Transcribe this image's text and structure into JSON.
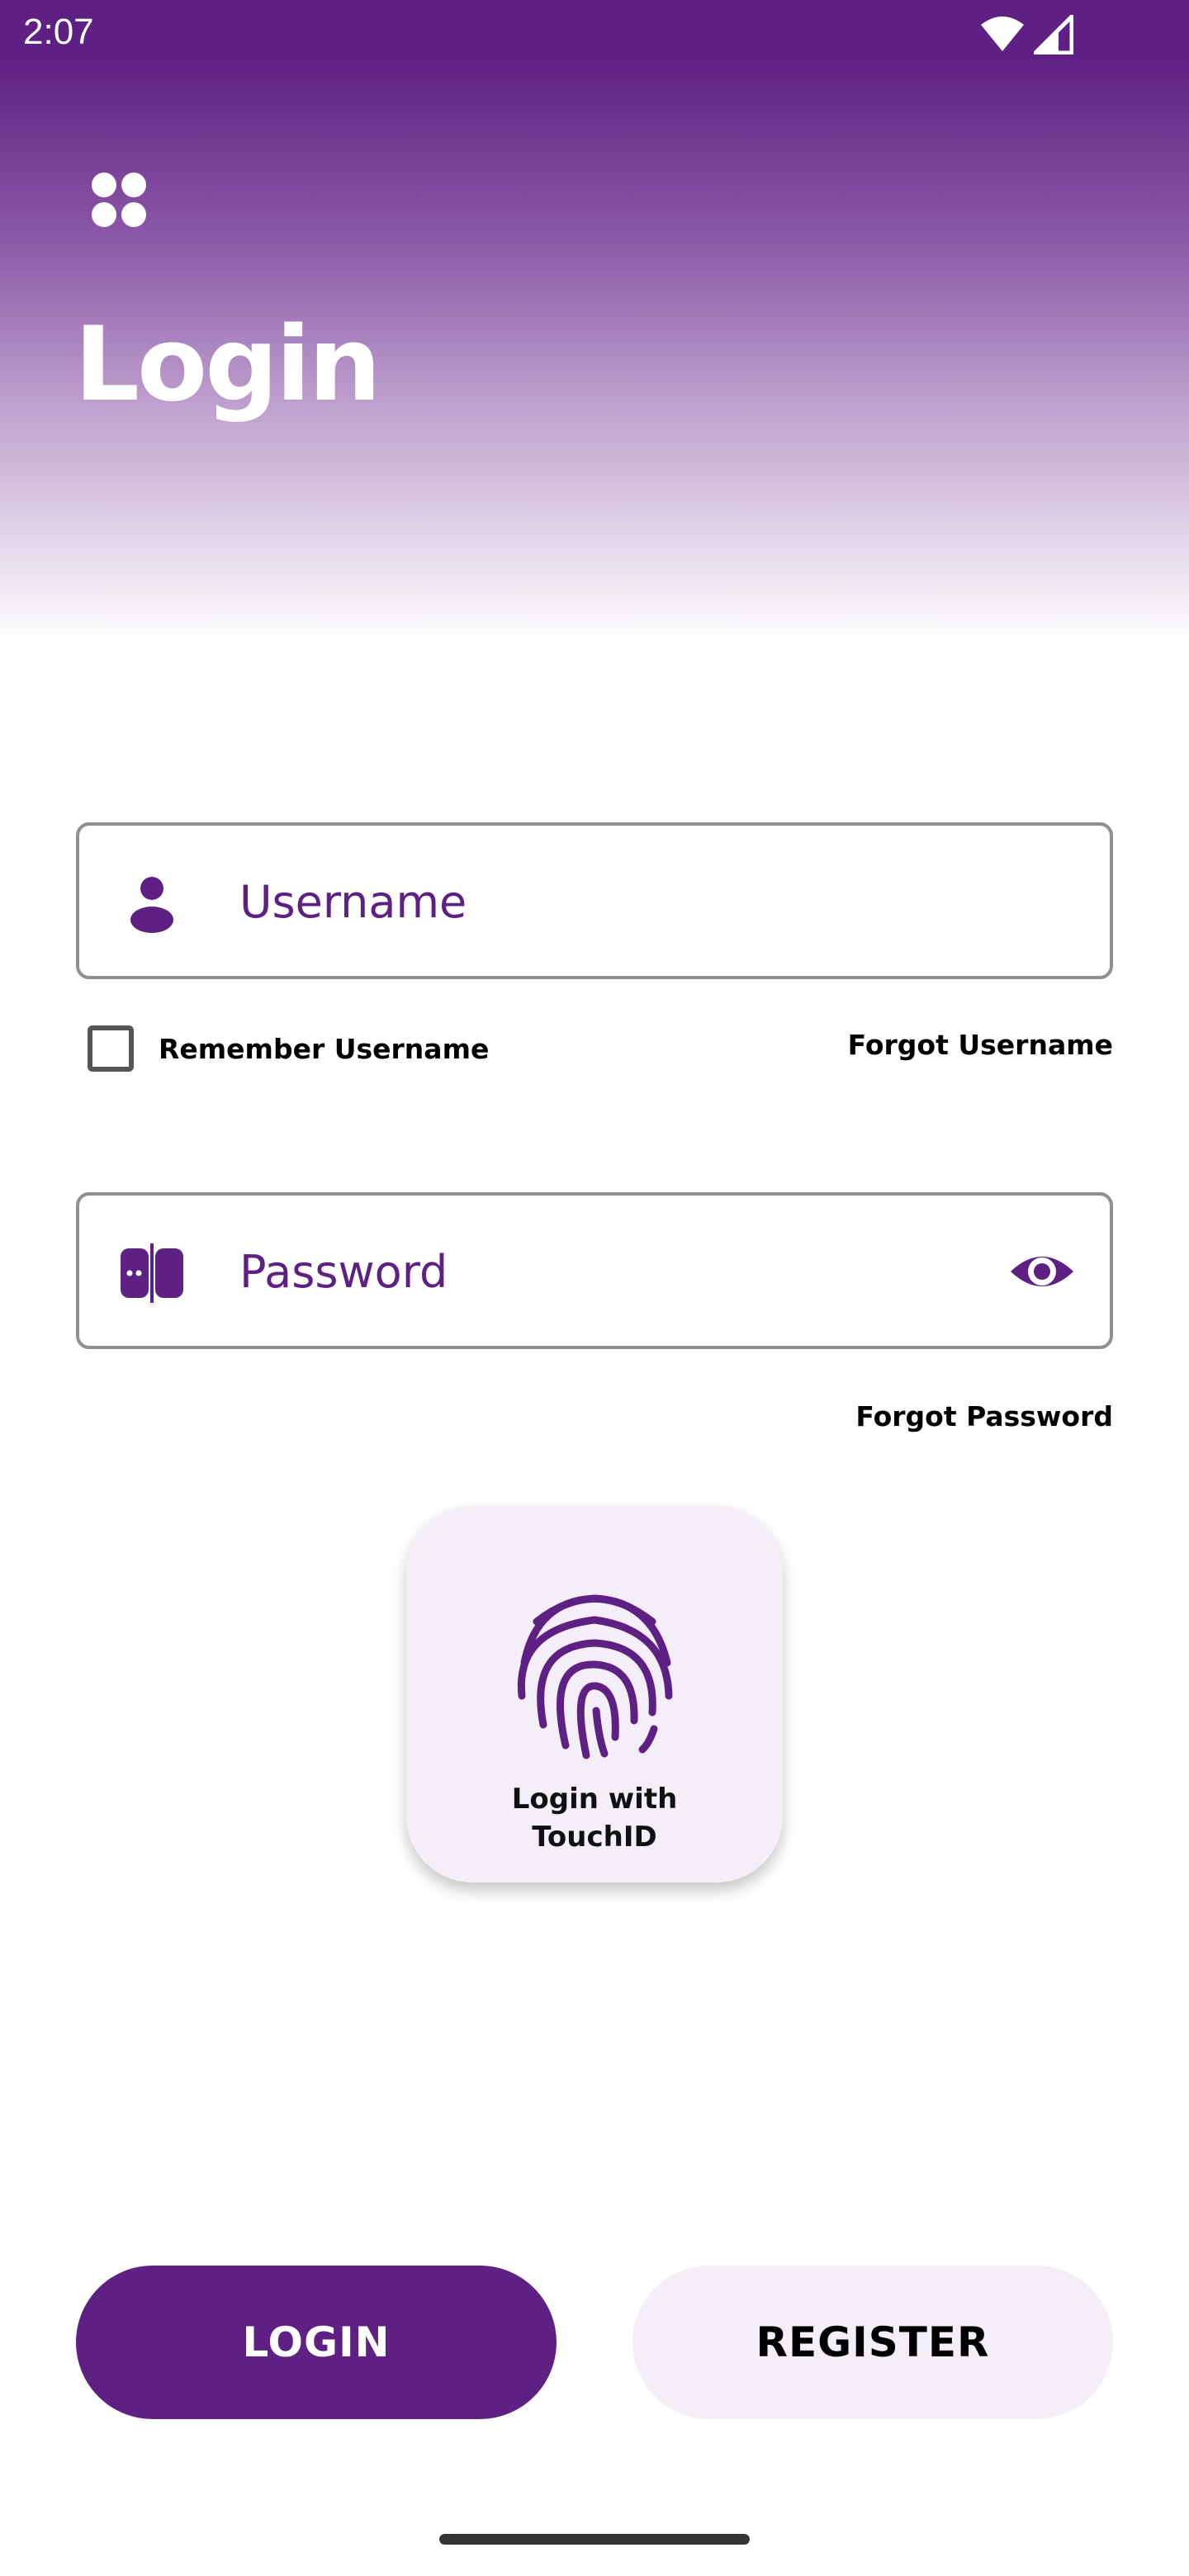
{
  "status_bar": {
    "time": "2:07",
    "icons": [
      "wifi-icon",
      "cell-signal-icon"
    ]
  },
  "header": {
    "title": "Login",
    "menu_icon": "apps-grid-icon"
  },
  "username_field": {
    "placeholder": "Username",
    "icon": "person-icon"
  },
  "remember": {
    "label": "Remember Username",
    "checked": false
  },
  "forgot_username": "Forgot Username",
  "password_field": {
    "placeholder": "Password",
    "icon": "password-lock-icon",
    "toggle_icon": "eye-icon"
  },
  "forgot_password": "Forgot Password",
  "touch_login": {
    "line1": "Login with",
    "line2": "TouchID",
    "icon": "fingerprint-icon"
  },
  "buttons": {
    "login": "LOGIN",
    "register": "REGISTER"
  },
  "colors": {
    "brand": "#5e2083",
    "card_bg": "#f3eef8",
    "border": "#8f8f8f"
  }
}
